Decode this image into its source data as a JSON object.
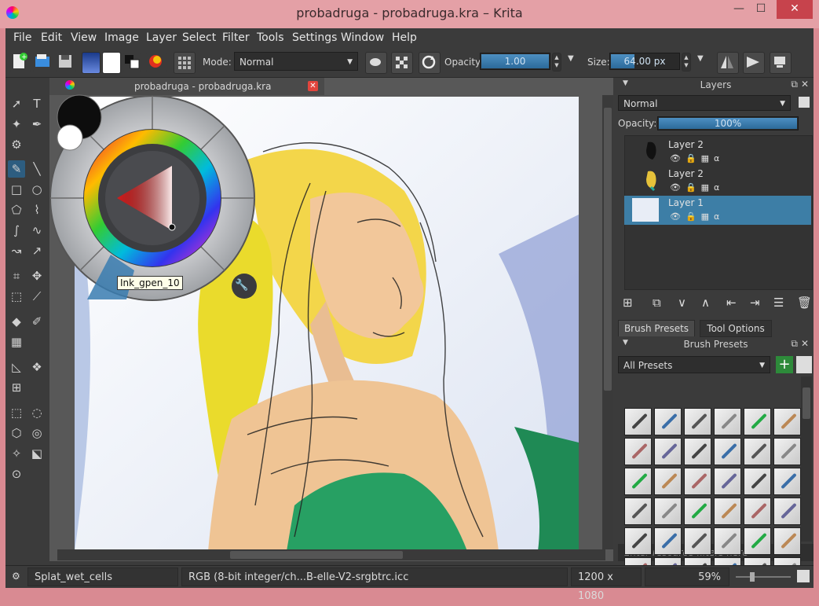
{
  "window": {
    "title": "probadruga - probadruga.kra – Krita",
    "min": "—",
    "max": "☐",
    "close": "✕"
  },
  "menu": [
    "File",
    "Edit",
    "View",
    "Image",
    "Layer",
    "Select",
    "Filter",
    "Tools",
    "Settings",
    "Window",
    "Help"
  ],
  "toolbar": {
    "mode_label": "Mode:",
    "mode_value": "Normal",
    "opacity_label": "Opacity:",
    "opacity_value": "1.00",
    "opacity_level": 1.0,
    "size_label": "Size:",
    "size_value": "64.00 px"
  },
  "document_tab": {
    "label": "probadruga - probadruga.kra",
    "close": "✕"
  },
  "popup": {
    "tooltip": "Ink_gpen_10"
  },
  "layers_panel": {
    "title": "Layers",
    "blend_mode": "Normal",
    "opacity_label": "Opacity:",
    "opacity_value": "100%",
    "opacity_level": 1.0,
    "layers": [
      {
        "name": "Layer 2",
        "selected": false
      },
      {
        "name": "Layer 2",
        "selected": false
      },
      {
        "name": "Layer 1",
        "selected": true
      }
    ]
  },
  "tabs": {
    "brush_presets": "Brush Presets",
    "tool_options": "Tool Options"
  },
  "brush_panel": {
    "title": "Brush Presets",
    "filter": "All Presets",
    "search_placeholder": "Enter resource filters here"
  },
  "status": {
    "brush": "Splat_wet_cells",
    "color": "RGB (8-bit integer/ch...B-elle-V2-srgbtrc.icc",
    "size": "1200 x 1080",
    "zoom": "59%"
  },
  "colors": {
    "accent": "#3d7ea6",
    "bg": "#3b3b3b",
    "title": "#e4a0a6"
  }
}
